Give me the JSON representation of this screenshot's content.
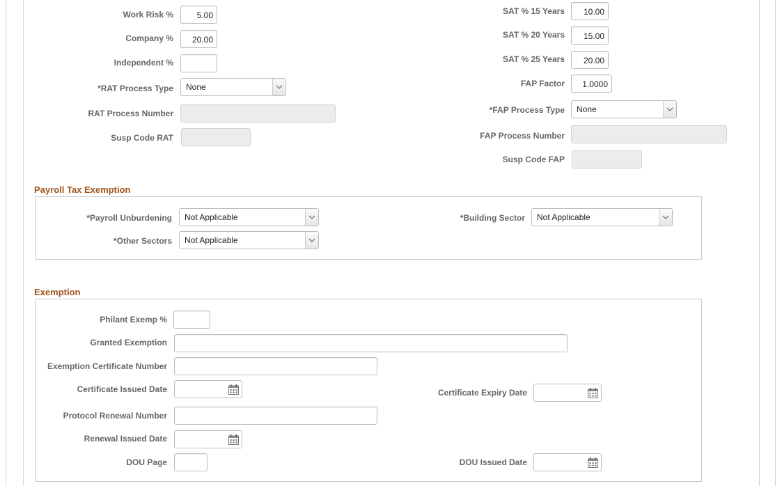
{
  "top_left": {
    "work_risk": {
      "label": "Work Risk %",
      "value": "5.00"
    },
    "company": {
      "label": "Company %",
      "value": "20.00"
    },
    "independent": {
      "label": "Independent %",
      "value": ""
    },
    "rat_process_type": {
      "label": "*RAT Process Type",
      "value": "None"
    },
    "rat_process_number": {
      "label": "RAT Process Number",
      "value": ""
    },
    "susp_code_rat": {
      "label": "Susp Code RAT",
      "value": ""
    }
  },
  "top_right": {
    "sat15": {
      "label": "SAT % 15 Years",
      "value": "10.00"
    },
    "sat20": {
      "label": "SAT % 20 Years",
      "value": "15.00"
    },
    "sat25": {
      "label": "SAT % 25 Years",
      "value": "20.00"
    },
    "fap_factor": {
      "label": "FAP Factor",
      "value": "1.0000"
    },
    "fap_process_type": {
      "label": "*FAP Process Type",
      "value": "None"
    },
    "fap_process_number": {
      "label": "FAP Process Number",
      "value": ""
    },
    "susp_code_fap": {
      "label": "Susp Code FAP",
      "value": ""
    }
  },
  "payroll_tax": {
    "title": "Payroll Tax Exemption",
    "payroll_unburdening": {
      "label": "*Payroll Unburdening",
      "value": "Not Applicable"
    },
    "other_sectors": {
      "label": "*Other Sectors",
      "value": "Not Applicable"
    },
    "building_sector": {
      "label": "*Building Sector",
      "value": "Not Applicable"
    }
  },
  "exemption": {
    "title": "Exemption",
    "philant_exemp": {
      "label": "Philant Exemp %",
      "value": ""
    },
    "granted_exemption": {
      "label": "Granted Exemption",
      "value": ""
    },
    "certificate_number": {
      "label": "Exemption Certificate Number",
      "value": ""
    },
    "certificate_issued_date": {
      "label": "Certificate Issued Date",
      "value": ""
    },
    "certificate_expiry_date": {
      "label": "Certificate Expiry Date",
      "value": ""
    },
    "protocol_renewal_number": {
      "label": "Protocol Renewal Number",
      "value": ""
    },
    "renewal_issued_date": {
      "label": "Renewal Issued Date",
      "value": ""
    },
    "dou_page": {
      "label": "DOU Page",
      "value": ""
    },
    "dou_issued_date": {
      "label": "DOU Issued Date",
      "value": ""
    }
  },
  "colors": {
    "section_title": "#a0531a",
    "label": "#666666",
    "disabled_field": "#ececec"
  }
}
